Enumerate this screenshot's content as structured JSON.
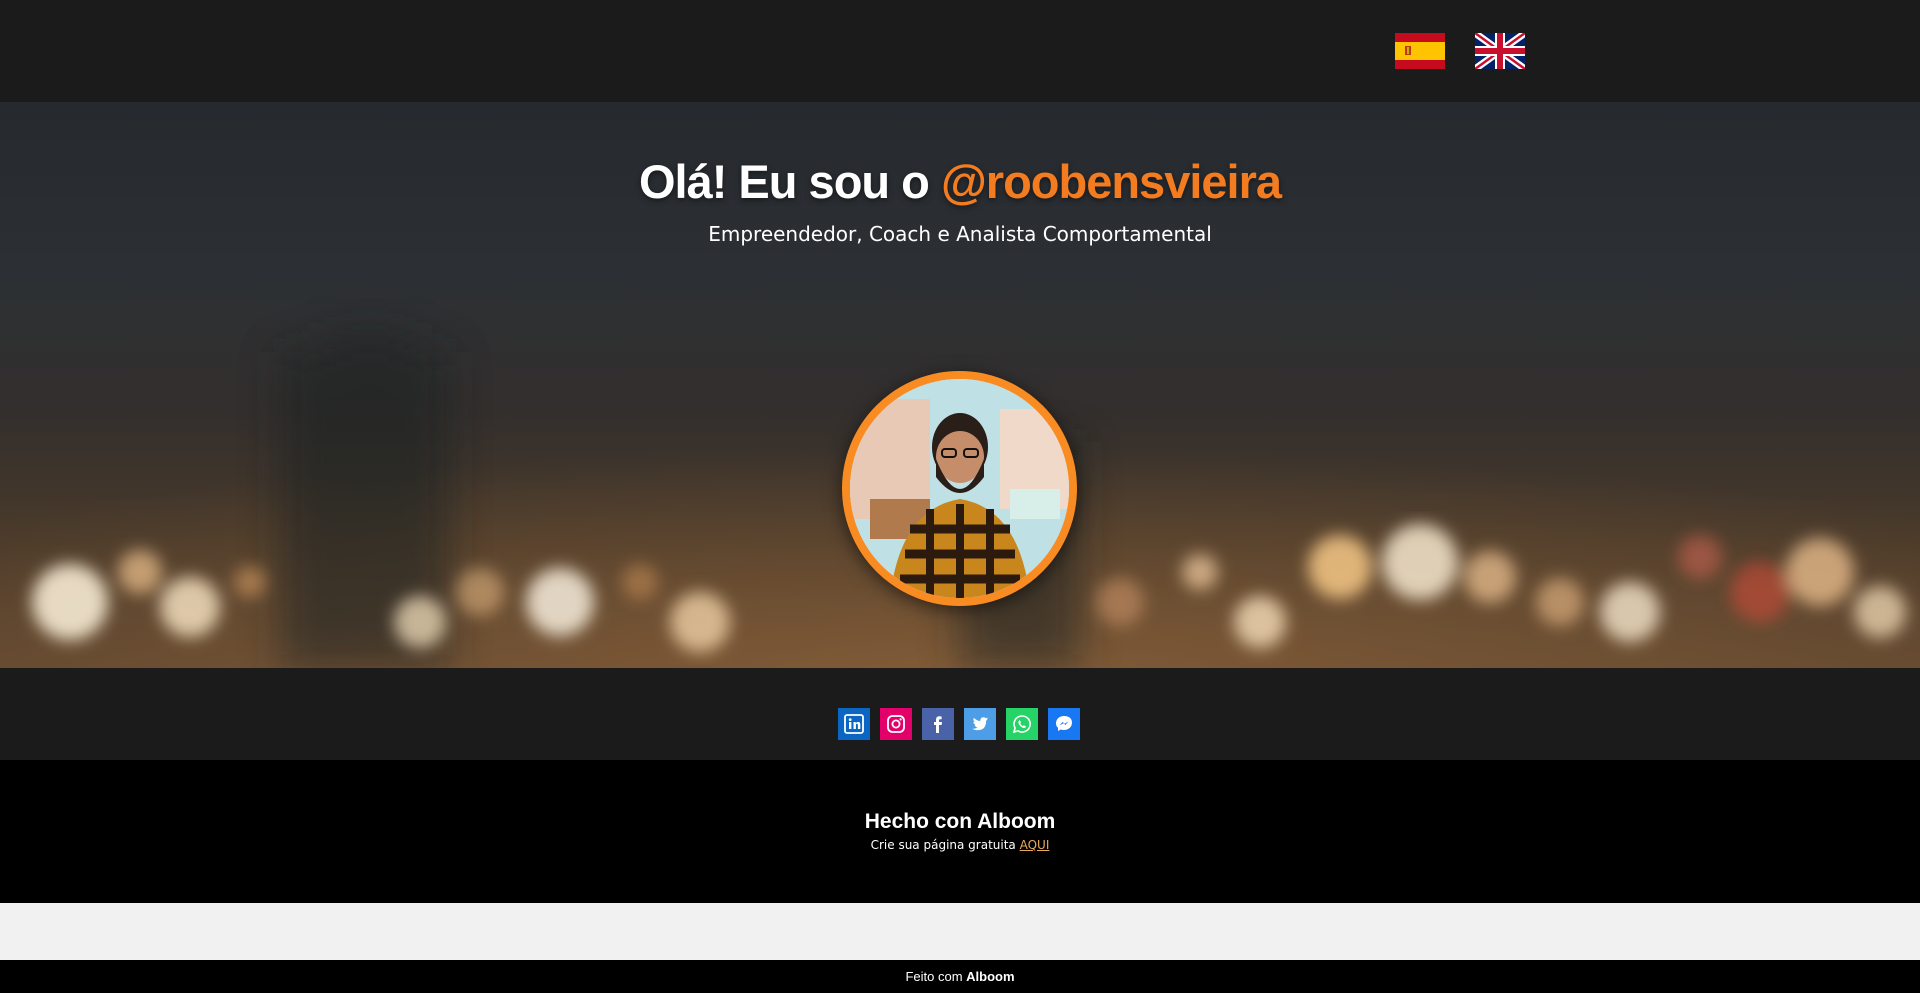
{
  "header": {
    "languages": [
      {
        "code": "es",
        "icon": "spain-flag-icon"
      },
      {
        "code": "en",
        "icon": "uk-flag-icon"
      }
    ]
  },
  "hero": {
    "greeting": "Olá! Eu sou o",
    "handle": "@roobensvieira",
    "subtitle": "Empreendedor, Coach e Analista Comportamental",
    "accent_color": "#f47c20",
    "avatar_border_color": "#f98b23"
  },
  "social": {
    "links": [
      {
        "icon": "linkedin-icon",
        "color": "#0a66c2"
      },
      {
        "icon": "instagram-icon",
        "color": "#e4006b"
      },
      {
        "icon": "facebook-icon",
        "color": "#4a63a8"
      },
      {
        "icon": "twitter-icon",
        "color": "#4d9ee6"
      },
      {
        "icon": "whatsapp-icon",
        "color": "#25d366"
      },
      {
        "icon": "messenger-icon",
        "color": "#1877f2"
      }
    ]
  },
  "footer": {
    "title": "Hecho con Alboom",
    "cta_text": "Crie sua página gratuita",
    "cta_link": "AQUI"
  },
  "bottom_bar": {
    "prefix": "Feito com",
    "brand": "Alboom"
  }
}
